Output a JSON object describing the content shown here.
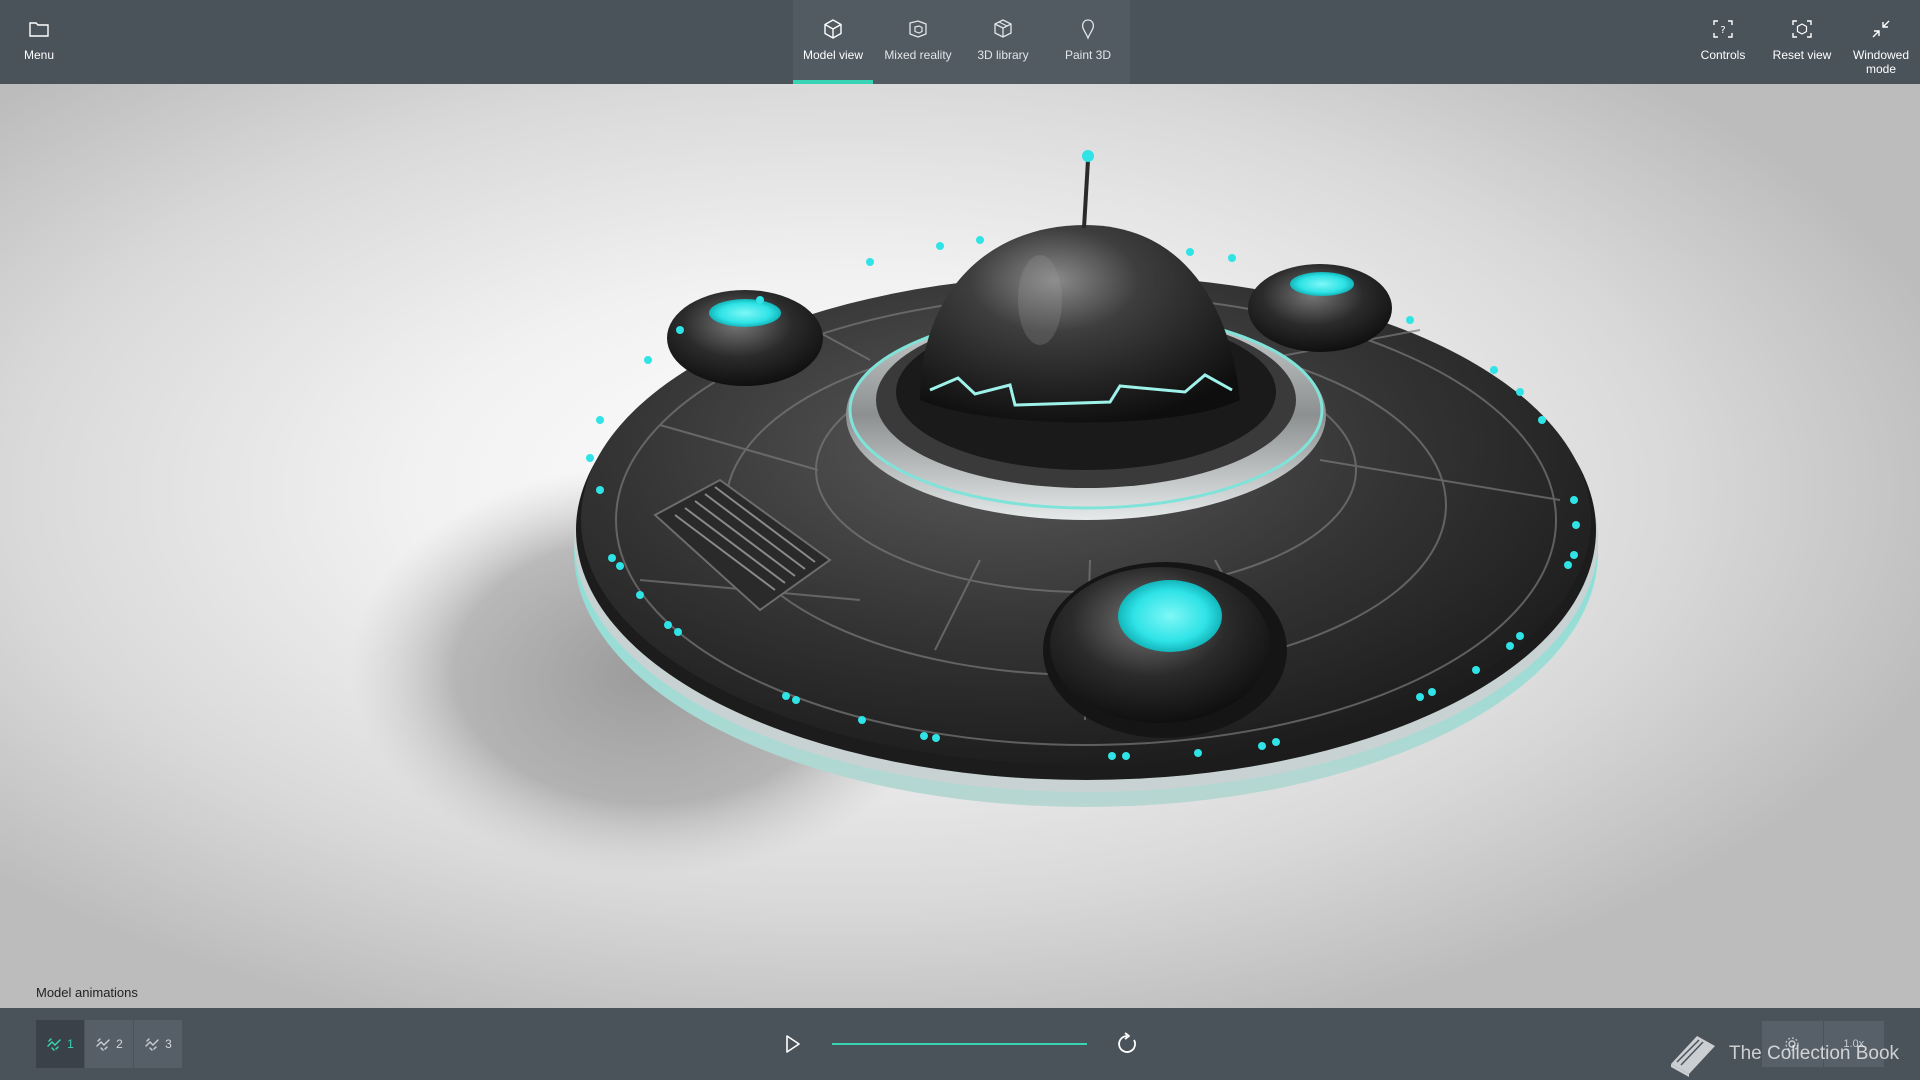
{
  "topbar": {
    "menu_label": "Menu",
    "tabs": [
      {
        "label": "Model view",
        "icon": "cube-icon",
        "active": true
      },
      {
        "label": "Mixed reality",
        "icon": "mixed-reality-icon",
        "active": false
      },
      {
        "label": "3D library",
        "icon": "3d-library-icon",
        "active": false
      },
      {
        "label": "Paint 3D",
        "icon": "paint-3d-icon",
        "active": false
      }
    ],
    "right": [
      {
        "label": "Controls",
        "icon": "controls-icon"
      },
      {
        "label": "Reset view",
        "icon": "reset-view-icon"
      },
      {
        "label": "Windowed mode",
        "icon": "windowed-mode-icon"
      }
    ]
  },
  "animations": {
    "title": "Model animations",
    "items": [
      {
        "label": "1",
        "active": true
      },
      {
        "label": "2",
        "active": false
      },
      {
        "label": "3",
        "active": false
      }
    ]
  },
  "playback": {
    "progress": 1.0,
    "speed_label": "1.0x"
  },
  "watermark": "The Collection Book",
  "colors": {
    "accent": "#39d4b4",
    "glow": "#2fe3e6",
    "bar": "#4a525a"
  }
}
